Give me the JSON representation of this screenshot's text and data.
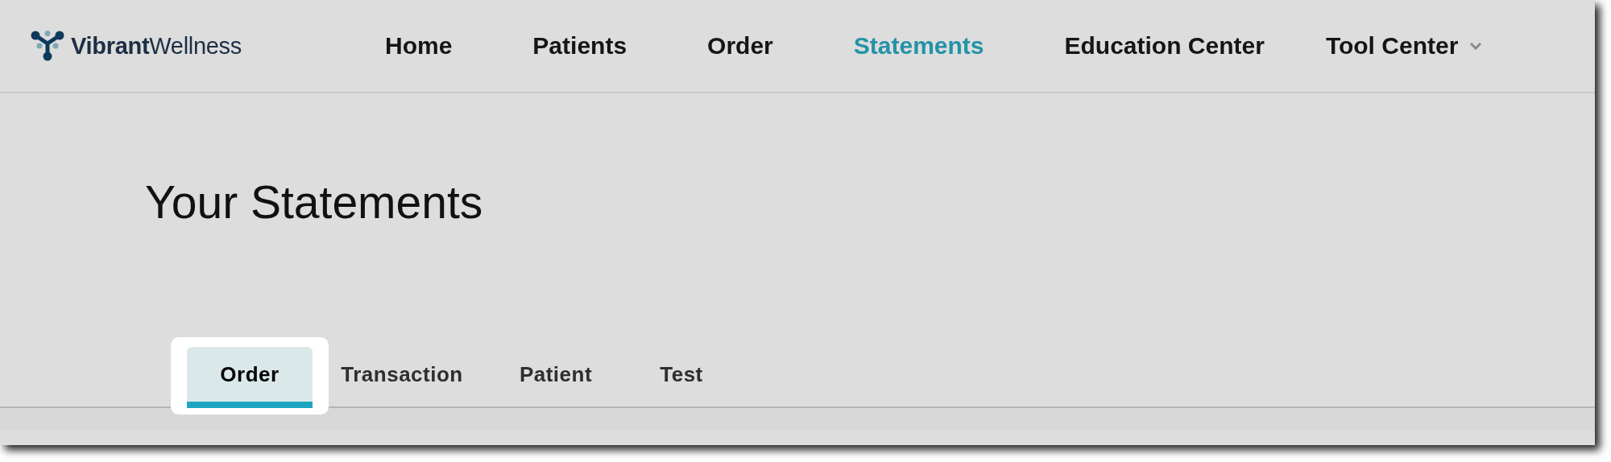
{
  "logo": {
    "text": "**Vibrant**Wellness"
  },
  "nav": [
    {
      "label": "Home",
      "selected": false,
      "dropdown": false
    },
    {
      "label": "Patients",
      "selected": false,
      "dropdown": false
    },
    {
      "label": "Order",
      "selected": false,
      "dropdown": false
    },
    {
      "label": "Statements",
      "selected": true,
      "dropdown": false
    },
    {
      "label": "Education Center",
      "selected": false,
      "dropdown": false
    },
    {
      "label": "Tool Center",
      "selected": false,
      "dropdown": true
    }
  ],
  "page_title": "Your Statements",
  "tabs": [
    {
      "label": "Order",
      "selected": true,
      "highlighted": true
    },
    {
      "label": "Transaction",
      "selected": false,
      "highlighted": false
    },
    {
      "label": "Patient",
      "selected": false,
      "highlighted": false
    },
    {
      "label": "Test",
      "selected": false,
      "highlighted": false
    }
  ]
}
